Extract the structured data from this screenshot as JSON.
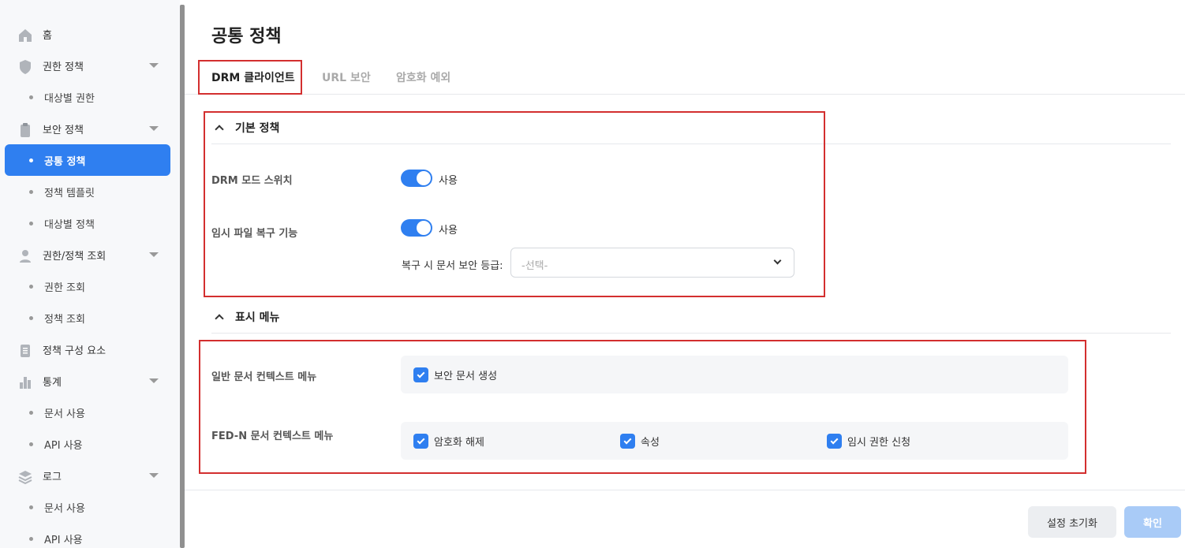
{
  "sidebar": {
    "items": [
      {
        "label": "홈",
        "icon": "home-icon"
      },
      {
        "label": "권한 정책",
        "icon": "shield-icon"
      },
      {
        "label": "대상별 권한"
      },
      {
        "label": "보안 정책",
        "icon": "clipboard-icon"
      },
      {
        "label": "공통 정책",
        "active": true
      },
      {
        "label": "정책 템플릿"
      },
      {
        "label": "대상별 정책"
      },
      {
        "label": "권한/정책 조회",
        "icon": "user-icon"
      },
      {
        "label": "권한 조회"
      },
      {
        "label": "정책 조회"
      },
      {
        "label": "정책 구성 요소",
        "icon": "document-icon"
      },
      {
        "label": "통계",
        "icon": "bar-chart-icon"
      },
      {
        "label": "문서 사용"
      },
      {
        "label": "API 사용"
      },
      {
        "label": "로그",
        "icon": "layers-icon"
      },
      {
        "label": "문서 사용"
      },
      {
        "label": "API 사용"
      }
    ]
  },
  "page": {
    "title": "공통 정책"
  },
  "tabs": [
    "DRM 클라이언트",
    "URL 보안",
    "암호화 예외"
  ],
  "basic_policy": {
    "title": "기본 정책",
    "drm_mode_label": "DRM 모드 스위치",
    "drm_mode_state": "사용",
    "temp_recovery_label": "임시 파일 복구 기능",
    "temp_recovery_state": "사용",
    "recovery_level_label": "복구 시 문서 보안 등급:",
    "recovery_level_value": "-선택-"
  },
  "display_menu": {
    "title": "표시 메뉴",
    "general_label": "일반 문서 컨텍스트 메뉴",
    "general_items": [
      "보안 문서 생성"
    ],
    "fedn_label": "FED-N 문서 컨텍스트 메뉴",
    "fedn_items": [
      "암호화 해제",
      "속성",
      "임시 권한 신청"
    ]
  },
  "buttons": {
    "reset": "설정 초기화",
    "ok": "확인"
  },
  "colors": {
    "accent": "#2f7ff0",
    "highlight_box": "#d32f2f"
  }
}
